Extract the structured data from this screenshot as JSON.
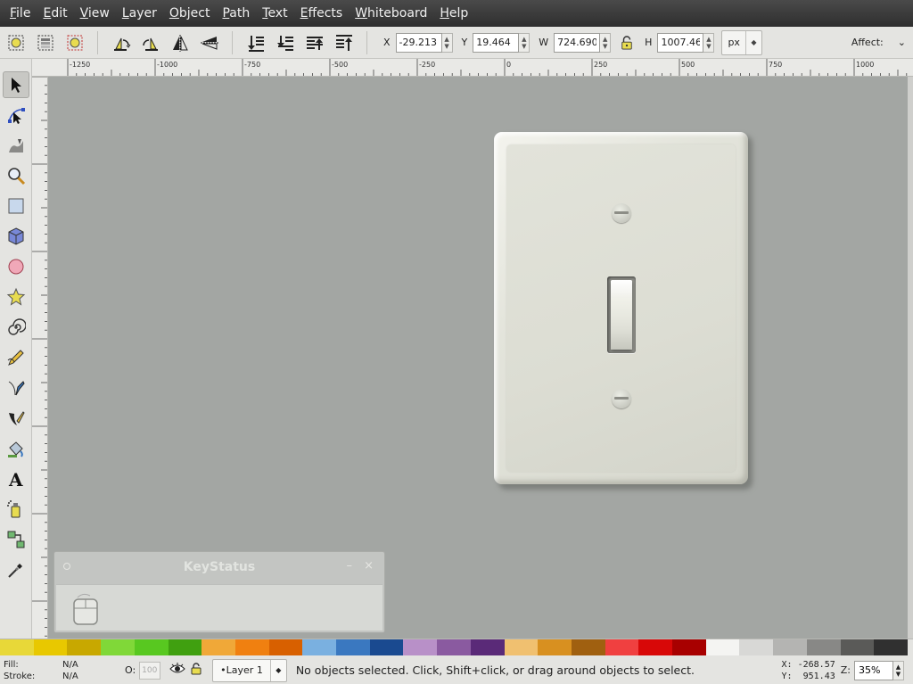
{
  "menu": [
    "File",
    "Edit",
    "View",
    "Layer",
    "Object",
    "Path",
    "Text",
    "Effects",
    "Whiteboard",
    "Help"
  ],
  "toolbar": {
    "x_label": "X",
    "x_value": "-29.213",
    "y_label": "Y",
    "y_value": "19.464",
    "w_label": "W",
    "w_value": "724.690",
    "h_label": "H",
    "h_value": "1007.46",
    "unit": "px",
    "affect_label": "Affect:",
    "icons": [
      "select-all-icon",
      "select-all-layers-icon",
      "deselect-icon",
      "rotate-ccw-icon",
      "rotate-cw-icon",
      "flip-horizontal-icon",
      "flip-vertical-icon",
      "lower-to-bottom-icon",
      "lower-icon",
      "raise-icon",
      "raise-to-top-icon"
    ]
  },
  "ruler": {
    "horizontal_labels": [
      "-1250",
      "-1000",
      "-750",
      "-500",
      "-250",
      "0",
      "250",
      "500",
      "750",
      "1000"
    ]
  },
  "tools": [
    "selector-tool",
    "node-tool",
    "tweak-tool",
    "zoom-tool",
    "rectangle-tool",
    "3d-box-tool",
    "ellipse-tool",
    "star-tool",
    "spiral-tool",
    "pencil-tool",
    "pen-tool",
    "calligraphy-tool",
    "paint-bucket-tool",
    "text-tool",
    "spray-tool",
    "connector-tool",
    "dropper-tool"
  ],
  "keystatus": {
    "title": "KeyStatus",
    "minimize": "–",
    "close": "×"
  },
  "palette": [
    "#e8d838",
    "#e8c800",
    "#c8a800",
    "#80d838",
    "#58c820",
    "#40a010",
    "#f0a838",
    "#f08010",
    "#d86000",
    "#7ab0e0",
    "#3a78c0",
    "#1a4a90",
    "#b890c8",
    "#8a5aa0",
    "#5a2a78",
    "#f0c070",
    "#d89020",
    "#a06010",
    "#f04040",
    "#d80808",
    "#a80000",
    "#f4f4f2",
    "#d8d8d6",
    "#b4b4b2",
    "#888886",
    "#5a5a58",
    "#303030"
  ],
  "status": {
    "fill_label": "Fill:",
    "stroke_label": "Stroke:",
    "fill_value": "N/A",
    "stroke_value": "N/A",
    "opacity_label": "O:",
    "opacity_value": "100",
    "layer": "•Layer 1",
    "message": "No objects selected. Click, Shift+click, or drag around objects to select.",
    "x_coord": "X: -268.57",
    "y_coord": "Y:  951.43",
    "zoom_label": "Z:",
    "zoom_value": "35%"
  },
  "colors": {
    "canvas": "#a3a6a3",
    "menubar": "#3a3a3a",
    "chrome": "#e4e4e1"
  }
}
